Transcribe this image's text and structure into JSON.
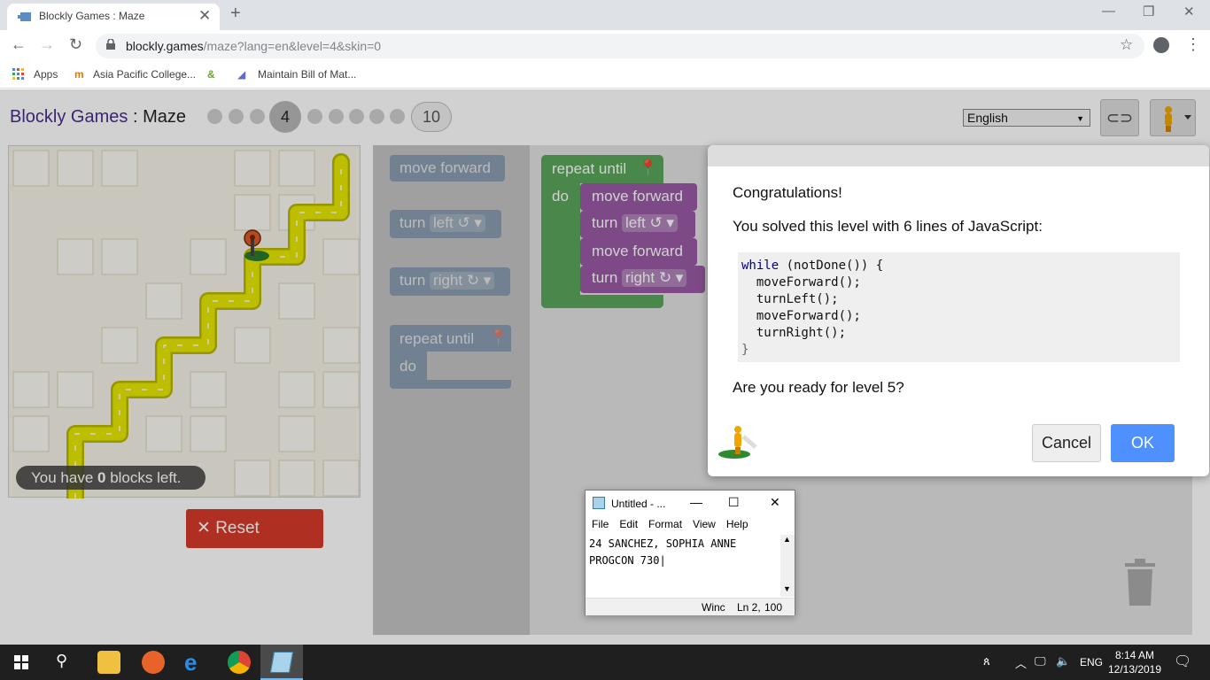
{
  "browser": {
    "tab_title": "Blockly Games : Maze",
    "tab_close": "✕",
    "new_tab": "+",
    "url_domain": "blockly.games",
    "url_path": "/maze?lang=en&level=4&skin=0",
    "bookmarks": [
      "Apps",
      "Asia Pacific College...",
      "Maintain Bill of Mat..."
    ]
  },
  "app": {
    "brand": "Blockly Games",
    "separator": ":",
    "game": "Maze",
    "current_level": "4",
    "last_level": "10",
    "language": "English"
  },
  "maze": {
    "blocks_left_prefix": "You have ",
    "blocks_left_count": "0",
    "blocks_left_suffix": " blocks left.",
    "reset_label": "Reset"
  },
  "toolbox": {
    "move_forward": "move forward",
    "turn": "turn",
    "left": "left ↺",
    "right": "right ↻",
    "repeat_until": "repeat until",
    "do": "do"
  },
  "workspace": {
    "repeat_until": "repeat until",
    "do": "do",
    "move_forward_1": "move forward",
    "turn_1": "turn",
    "turn_1_dir": "left ↺",
    "move_forward_2": "move forward",
    "turn_2": "turn",
    "turn_2_dir": "right ↻"
  },
  "dialog": {
    "congrats": "Congratulations!",
    "solved": "You solved this level with 6 lines of JavaScript:",
    "code_kw": "while",
    "code_line1_rest": " (notDone()) {",
    "code_line2": "  moveForward();",
    "code_line3": "  turnLeft();",
    "code_line4": "  moveForward();",
    "code_line5": "  turnRight();",
    "code_line6": "}",
    "ready": "Are you ready for level 5?",
    "cancel": "Cancel",
    "ok": "OK"
  },
  "notepad": {
    "title": "Untitled - ...",
    "menu": [
      "File",
      "Edit",
      "Format",
      "View",
      "Help"
    ],
    "line1": "24 SANCHEZ, SOPHIA ANNE",
    "line2": "PROGCON 730",
    "status_win": "Winc",
    "status_ln": "Ln 2,",
    "status_zoom": "100"
  },
  "taskbar": {
    "lang": "ENG",
    "time": "8:14 AM",
    "date": "12/13/2019"
  },
  "colors": {
    "brand": "#4a2d8a",
    "ok_button": "#4d90fe",
    "reset_button": "#d63a2a",
    "path": "#e0e000"
  }
}
